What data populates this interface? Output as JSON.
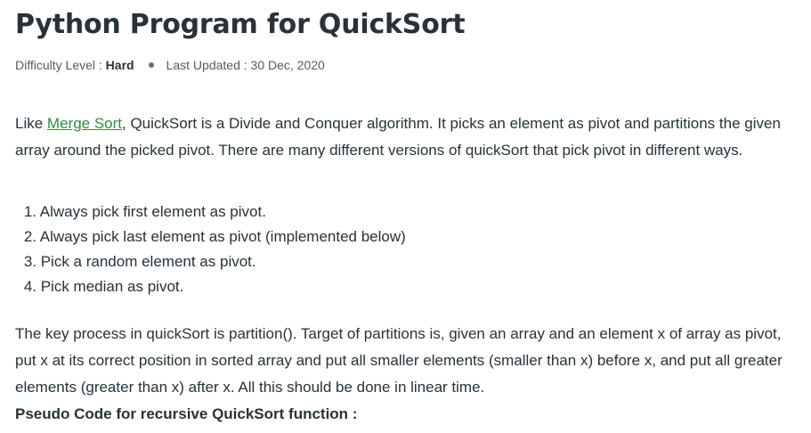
{
  "article": {
    "title": "Python Program for QuickSort",
    "meta": {
      "difficulty_label": "Difficulty Level : ",
      "difficulty_value": "Hard",
      "updated_label": "Last Updated : ",
      "updated_value": "30 Dec, 2020"
    },
    "intro": {
      "prefix": "Like ",
      "link_text": "Merge Sort",
      "suffix": ", QuickSort is a Divide and Conquer algorithm. It picks an element as pivot and partitions the given array around the picked pivot. There are many different versions of quickSort that pick pivot in different ways."
    },
    "pivot_options": [
      {
        "num": "1.",
        "text": " Always pick first element as pivot."
      },
      {
        "num": "2.",
        "text": " Always pick last element as pivot (implemented below)"
      },
      {
        "num": "3.",
        "text": " Pick a random element as pivot."
      },
      {
        "num": "4.",
        "text": " Pick median as pivot."
      }
    ],
    "partition_paragraph": "The key process in quickSort is partition(). Target of partitions is, given an array and an element x of array as pivot, put x at its correct position in sorted array and put all smaller elements (smaller than x) before x, and put all greater elements (greater than x) after x. All this should be done in linear time.",
    "pseudo_heading": "Pseudo Code for recursive QuickSort function :"
  }
}
